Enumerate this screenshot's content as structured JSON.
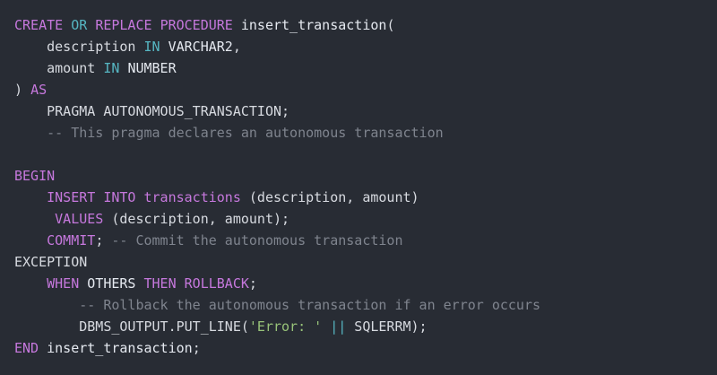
{
  "colors": {
    "background": "#282c34",
    "keyword": "#c678dd",
    "type": "#56b6c2",
    "identifier": "#e5e9f0",
    "comment": "#7f848e",
    "string": "#98c379",
    "plain": "#d7dae0"
  },
  "code": {
    "language": "PL/SQL",
    "lines": [
      [
        {
          "t": "keyword",
          "v": "CREATE"
        },
        {
          "t": "plain",
          "v": " "
        },
        {
          "t": "type",
          "v": "OR"
        },
        {
          "t": "plain",
          "v": " "
        },
        {
          "t": "keyword",
          "v": "REPLACE"
        },
        {
          "t": "plain",
          "v": " "
        },
        {
          "t": "keyword",
          "v": "PROCEDURE"
        },
        {
          "t": "plain",
          "v": " "
        },
        {
          "t": "identifier",
          "v": "insert_transaction"
        },
        {
          "t": "punct",
          "v": "("
        }
      ],
      [
        {
          "t": "plain",
          "v": "    description "
        },
        {
          "t": "type",
          "v": "IN"
        },
        {
          "t": "plain",
          "v": " "
        },
        {
          "t": "identifier",
          "v": "VARCHAR2"
        },
        {
          "t": "punct",
          "v": ","
        }
      ],
      [
        {
          "t": "plain",
          "v": "    amount "
        },
        {
          "t": "type",
          "v": "IN"
        },
        {
          "t": "plain",
          "v": " "
        },
        {
          "t": "identifier",
          "v": "NUMBER"
        }
      ],
      [
        {
          "t": "punct",
          "v": ") "
        },
        {
          "t": "keyword",
          "v": "AS"
        }
      ],
      [
        {
          "t": "plain",
          "v": "    PRAGMA AUTONOMOUS_TRANSACTION;"
        }
      ],
      [
        {
          "t": "plain",
          "v": "    "
        },
        {
          "t": "comment",
          "v": "-- This pragma declares an autonomous transaction"
        }
      ],
      [],
      [
        {
          "t": "keyword",
          "v": "BEGIN"
        }
      ],
      [
        {
          "t": "plain",
          "v": "    "
        },
        {
          "t": "keyword",
          "v": "INSERT"
        },
        {
          "t": "plain",
          "v": " "
        },
        {
          "t": "keyword",
          "v": "INTO"
        },
        {
          "t": "plain",
          "v": " "
        },
        {
          "t": "keyword",
          "v": "transactions"
        },
        {
          "t": "plain",
          "v": " "
        },
        {
          "t": "punct",
          "v": "(description, amount)"
        }
      ],
      [
        {
          "t": "plain",
          "v": "     "
        },
        {
          "t": "keyword",
          "v": "VALUES"
        },
        {
          "t": "plain",
          "v": " "
        },
        {
          "t": "punct",
          "v": "(description, amount);"
        }
      ],
      [
        {
          "t": "plain",
          "v": "    "
        },
        {
          "t": "keyword",
          "v": "COMMIT"
        },
        {
          "t": "punct",
          "v": "; "
        },
        {
          "t": "comment",
          "v": "-- Commit the autonomous transaction"
        }
      ],
      [
        {
          "t": "plain",
          "v": "EXCEPTION"
        }
      ],
      [
        {
          "t": "plain",
          "v": "    "
        },
        {
          "t": "keyword",
          "v": "WHEN"
        },
        {
          "t": "plain",
          "v": " "
        },
        {
          "t": "identifier",
          "v": "OTHERS"
        },
        {
          "t": "plain",
          "v": " "
        },
        {
          "t": "keyword",
          "v": "THEN"
        },
        {
          "t": "plain",
          "v": " "
        },
        {
          "t": "keyword",
          "v": "ROLLBACK"
        },
        {
          "t": "punct",
          "v": ";"
        }
      ],
      [
        {
          "t": "plain",
          "v": "        "
        },
        {
          "t": "comment",
          "v": "-- Rollback the autonomous transaction if an error occurs"
        }
      ],
      [
        {
          "t": "plain",
          "v": "        DBMS_OUTPUT.PUT_LINE("
        },
        {
          "t": "string",
          "v": "'Error: '"
        },
        {
          "t": "plain",
          "v": " "
        },
        {
          "t": "type",
          "v": "||"
        },
        {
          "t": "plain",
          "v": " SQLERRM);"
        }
      ],
      [
        {
          "t": "keyword",
          "v": "END"
        },
        {
          "t": "plain",
          "v": " "
        },
        {
          "t": "identifier",
          "v": "insert_transaction"
        },
        {
          "t": "punct",
          "v": ";"
        }
      ]
    ]
  }
}
